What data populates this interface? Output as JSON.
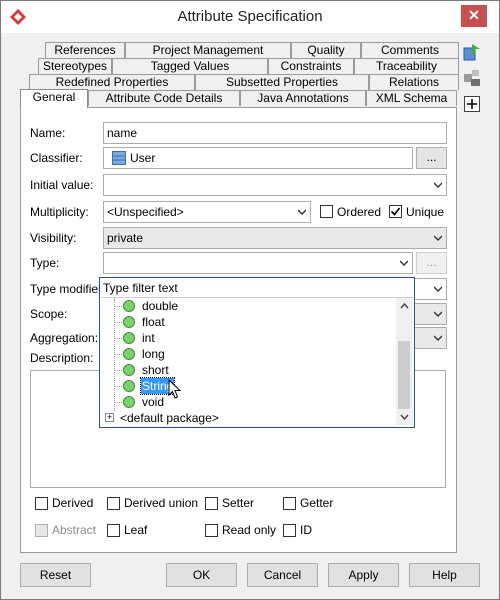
{
  "window": {
    "title": "Attribute Specification",
    "close_glyph": "✕"
  },
  "tabs": {
    "row1": [
      "References",
      "Project Management",
      "Quality",
      "Comments"
    ],
    "row2": [
      "Stereotypes",
      "Tagged Values",
      "Constraints",
      "Traceability"
    ],
    "row3": [
      "Redefined Properties",
      "Subsetted Properties",
      "Relations"
    ],
    "row4": [
      "General",
      "Attribute Code Details",
      "Java Annotations",
      "XML Schema"
    ],
    "active": "General"
  },
  "form": {
    "name_label": "Name:",
    "name_value": "name",
    "classifier_label": "Classifier:",
    "classifier_value": "User",
    "classifier_button": "...",
    "initial_value_label": "Initial value:",
    "initial_value": "",
    "multiplicity_label": "Multiplicity:",
    "multiplicity_value": "<Unspecified>",
    "ordered_label": "Ordered",
    "ordered_checked": false,
    "unique_label": "Unique",
    "unique_checked": true,
    "visibility_label": "Visibility:",
    "visibility_value": "private",
    "type_label": "Type:",
    "type_value": "",
    "type_button": "...",
    "type_modifier_label": "Type modifier:",
    "scope_label": "Scope:",
    "aggregation_label": "Aggregation:",
    "description_label": "Description:"
  },
  "dropdown": {
    "filter_placeholder": "Type filter text",
    "items": [
      "double",
      "float",
      "int",
      "long",
      "short",
      "String",
      "void"
    ],
    "selected": "String",
    "package_label": "<default package>",
    "expand_glyph": "+"
  },
  "checkboxes": {
    "derived": "Derived",
    "derived_union": "Derived union",
    "setter": "Setter",
    "getter": "Getter",
    "abstract": "Abstract",
    "leaf": "Leaf",
    "read_only": "Read only",
    "id": "ID"
  },
  "buttons": {
    "reset": "Reset",
    "ok": "OK",
    "cancel": "Cancel",
    "apply": "Apply",
    "help": "Help"
  },
  "colors": {
    "selection": "#3399ff",
    "close_button": "#c75050",
    "popup_border": "#2b4ea3",
    "green_icon": "#7ad06a"
  }
}
